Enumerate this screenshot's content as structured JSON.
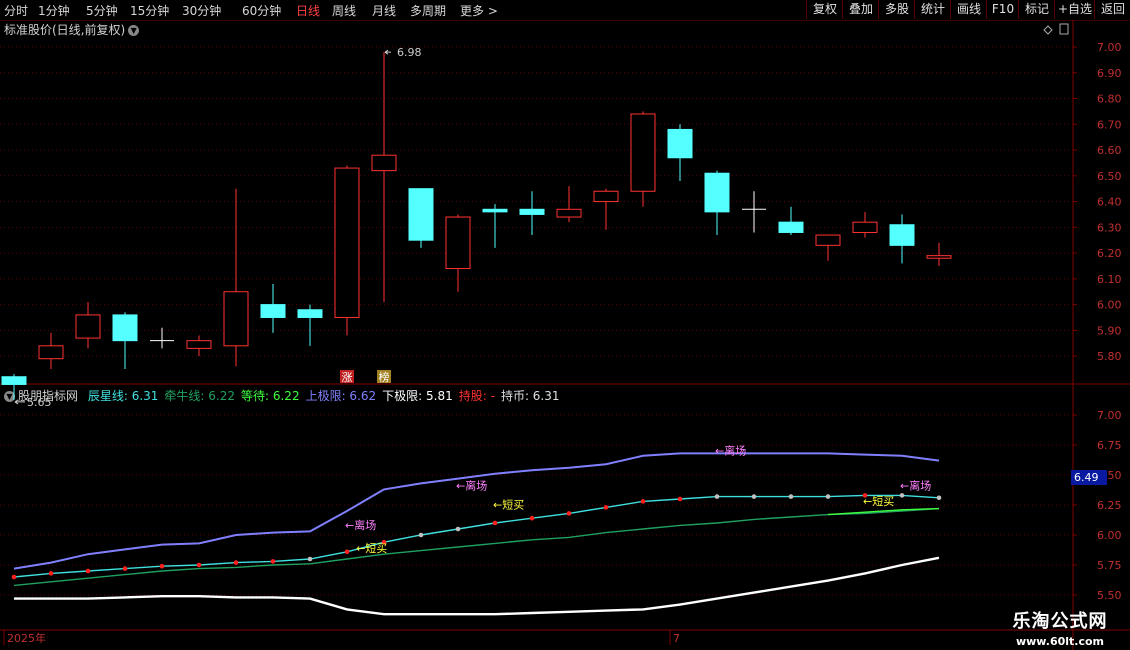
{
  "toolbar": {
    "left_items": [
      {
        "label": "分时",
        "active": false
      },
      {
        "label": "1分钟",
        "active": false
      },
      {
        "label": "5分钟",
        "active": false
      },
      {
        "label": "15分钟",
        "active": false
      },
      {
        "label": "30分钟",
        "active": false
      },
      {
        "label": "60分钟",
        "active": false
      },
      {
        "label": "日线",
        "active": true
      },
      {
        "label": "周线",
        "active": false
      },
      {
        "label": "月线",
        "active": false
      },
      {
        "label": "多周期",
        "active": false
      },
      {
        "label": "更多 >",
        "active": false
      }
    ],
    "right_items": [
      "复权",
      "叠加",
      "多股",
      "统计",
      "画线",
      "F10",
      "标记",
      "+自选",
      "返回"
    ]
  },
  "main_chart": {
    "title": "标准股价(日线,前复权)",
    "high_label": "6.98",
    "low_label": "5.65",
    "badges": [
      "涨",
      "榜"
    ]
  },
  "indicator": {
    "name": "股朋指标网",
    "values": [
      {
        "label": "辰星线: 6.31",
        "color": "#40e0e0"
      },
      {
        "label": "牵牛线: 6.22",
        "color": "#20a060"
      },
      {
        "label": "等待: 6.22",
        "color": "#40ff40"
      },
      {
        "label": "上极限: 6.62",
        "color": "#8080ff"
      },
      {
        "label": "下极限: 5.81",
        "color": "#ffffff"
      },
      {
        "label": "持股: -",
        "color": "#ff3030"
      },
      {
        "label": "持币: 6.31",
        "color": "#e0e0e0"
      }
    ],
    "current_value": "6.49",
    "annotations": [
      {
        "text": "←离场",
        "color": "#ff80ff",
        "x": 12,
        "y": 6.38
      },
      {
        "text": "←离场",
        "color": "#ff80ff",
        "x": 9,
        "y": 6.05
      },
      {
        "text": "←离场",
        "color": "#ff80ff",
        "x": 19,
        "y": 6.67
      },
      {
        "text": "←离场",
        "color": "#ff80ff",
        "x": 24,
        "y": 6.38
      },
      {
        "text": "←短买",
        "color": "#ffff40",
        "x": 13,
        "y": 6.22
      },
      {
        "text": "←短买",
        "color": "#ffff40",
        "x": 9.3,
        "y": 5.86
      },
      {
        "text": "←短买",
        "color": "#ffff40",
        "x": 23,
        "y": 6.25
      }
    ]
  },
  "date_axis": {
    "labels": [
      {
        "text": "2025年",
        "x": 0
      },
      {
        "text": "7",
        "x": 18
      }
    ]
  },
  "watermark": {
    "line1": "乐淘公式网",
    "line2": "www.60lt.com"
  },
  "chart_data": [
    {
      "type": "candlestick",
      "title": "标准股价(日线,前复权)",
      "ylim": [
        5.7,
        7.05
      ],
      "yticks": [
        5.8,
        5.9,
        6.0,
        6.1,
        6.2,
        6.3,
        6.4,
        6.5,
        6.6,
        6.7,
        6.8,
        6.9,
        7.0
      ],
      "candles": [
        {
          "o": 5.72,
          "h": 5.73,
          "l": 5.63,
          "c": 5.69
        },
        {
          "o": 5.79,
          "h": 5.89,
          "l": 5.75,
          "c": 5.84
        },
        {
          "o": 5.87,
          "h": 6.01,
          "l": 5.83,
          "c": 5.96
        },
        {
          "o": 5.96,
          "h": 5.97,
          "l": 5.75,
          "c": 5.86
        },
        {
          "o": 5.86,
          "h": 5.91,
          "l": 5.83,
          "c": 5.86
        },
        {
          "o": 5.83,
          "h": 5.88,
          "l": 5.8,
          "c": 5.86
        },
        {
          "o": 5.84,
          "h": 6.45,
          "l": 5.76,
          "c": 6.05
        },
        {
          "o": 6.0,
          "h": 6.08,
          "l": 5.89,
          "c": 5.95
        },
        {
          "o": 5.98,
          "h": 6.0,
          "l": 5.84,
          "c": 5.95
        },
        {
          "o": 5.95,
          "h": 6.54,
          "l": 5.88,
          "c": 6.53
        },
        {
          "o": 6.52,
          "h": 6.98,
          "l": 6.01,
          "c": 6.58
        },
        {
          "o": 6.45,
          "h": 6.45,
          "l": 6.22,
          "c": 6.25
        },
        {
          "o": 6.14,
          "h": 6.35,
          "l": 6.05,
          "c": 6.34
        },
        {
          "o": 6.37,
          "h": 6.39,
          "l": 6.22,
          "c": 6.36
        },
        {
          "o": 6.37,
          "h": 6.44,
          "l": 6.27,
          "c": 6.35
        },
        {
          "o": 6.34,
          "h": 6.46,
          "l": 6.32,
          "c": 6.37
        },
        {
          "o": 6.4,
          "h": 6.45,
          "l": 6.29,
          "c": 6.44
        },
        {
          "o": 6.44,
          "h": 6.75,
          "l": 6.38,
          "c": 6.74
        },
        {
          "o": 6.68,
          "h": 6.7,
          "l": 6.48,
          "c": 6.57
        },
        {
          "o": 6.51,
          "h": 6.52,
          "l": 6.27,
          "c": 6.36
        },
        {
          "o": 6.37,
          "h": 6.44,
          "l": 6.28,
          "c": 6.37
        },
        {
          "o": 6.32,
          "h": 6.38,
          "l": 6.27,
          "c": 6.28
        },
        {
          "o": 6.23,
          "h": 6.27,
          "l": 6.17,
          "c": 6.27
        },
        {
          "o": 6.28,
          "h": 6.36,
          "l": 6.26,
          "c": 6.32
        },
        {
          "o": 6.31,
          "h": 6.35,
          "l": 6.16,
          "c": 6.23
        },
        {
          "o": 6.18,
          "h": 6.24,
          "l": 6.15,
          "c": 6.19
        }
      ]
    },
    {
      "type": "line",
      "title": "股朋指标网",
      "ylim": [
        5.5,
        7.1
      ],
      "yticks": [
        5.5,
        5.75,
        6.0,
        6.25,
        6.5,
        6.75,
        7.0
      ],
      "series": [
        {
          "name": "上极限",
          "color": "#8080ff",
          "values": [
            5.72,
            5.77,
            5.84,
            5.88,
            5.92,
            5.93,
            6.0,
            6.02,
            6.03,
            6.2,
            6.38,
            6.43,
            6.47,
            6.51,
            6.54,
            6.56,
            6.59,
            6.66,
            6.68,
            6.68,
            6.68,
            6.68,
            6.68,
            6.67,
            6.66,
            6.62
          ]
        },
        {
          "name": "辰星线",
          "color": "#40e0e0",
          "values": [
            5.65,
            5.68,
            5.7,
            5.72,
            5.74,
            5.75,
            5.77,
            5.78,
            5.8,
            5.86,
            5.94,
            6.0,
            6.05,
            6.1,
            6.14,
            6.18,
            6.23,
            6.28,
            6.3,
            6.32,
            6.32,
            6.32,
            6.32,
            6.33,
            6.33,
            6.31
          ]
        },
        {
          "name": "牵牛线",
          "color": "#20a060",
          "values": [
            5.58,
            5.61,
            5.64,
            5.67,
            5.7,
            5.72,
            5.73,
            5.75,
            5.76,
            5.8,
            5.84,
            5.87,
            5.9,
            5.93,
            5.96,
            5.98,
            6.02,
            6.05,
            6.08,
            6.1,
            6.13,
            6.15,
            6.17,
            6.18,
            6.2,
            6.22
          ]
        },
        {
          "name": "等待",
          "color": "#40ff40",
          "values": [
            null,
            null,
            null,
            null,
            null,
            null,
            null,
            null,
            null,
            null,
            null,
            null,
            null,
            null,
            null,
            null,
            null,
            null,
            null,
            null,
            null,
            null,
            6.17,
            6.19,
            6.21,
            6.22
          ]
        },
        {
          "name": "下极限",
          "color": "#ffffff",
          "values": [
            5.47,
            5.47,
            5.47,
            5.48,
            5.49,
            5.49,
            5.48,
            5.48,
            5.47,
            5.38,
            5.34,
            5.34,
            5.34,
            5.34,
            5.35,
            5.36,
            5.37,
            5.38,
            5.42,
            5.47,
            5.52,
            5.57,
            5.62,
            5.68,
            5.75,
            5.81
          ]
        }
      ],
      "dots": [
        {
          "color": "#ff2020",
          "idx": [
            0,
            1,
            2,
            3,
            4,
            5,
            6,
            7,
            9,
            10,
            13,
            14,
            15,
            16,
            17,
            18,
            23
          ]
        },
        {
          "color": "#c0c0c0",
          "idx": [
            8,
            11,
            12,
            19,
            20,
            21,
            22,
            24,
            25
          ]
        }
      ]
    }
  ]
}
